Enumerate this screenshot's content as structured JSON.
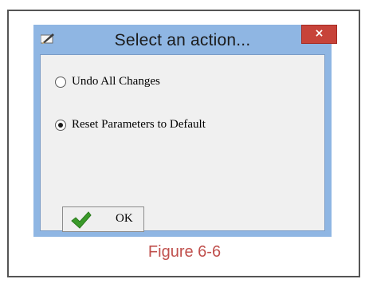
{
  "dialog": {
    "title": "Select an action...",
    "app_icon": "pen-icon",
    "close_glyph": "×",
    "close_icon": "close-icon",
    "colors": {
      "frame": "#8fb6e3",
      "close": "#c7433a",
      "client": "#f0f0f0"
    }
  },
  "options": [
    {
      "label": "Undo All Changes",
      "selected": false
    },
    {
      "label": "Reset Parameters to Default",
      "selected": true
    }
  ],
  "ok_button": {
    "label": "OK",
    "icon": "checkmark-icon",
    "icon_color": "#3a9a2a"
  },
  "caption": {
    "text": "Figure 6-6",
    "color": "#c0504d"
  }
}
